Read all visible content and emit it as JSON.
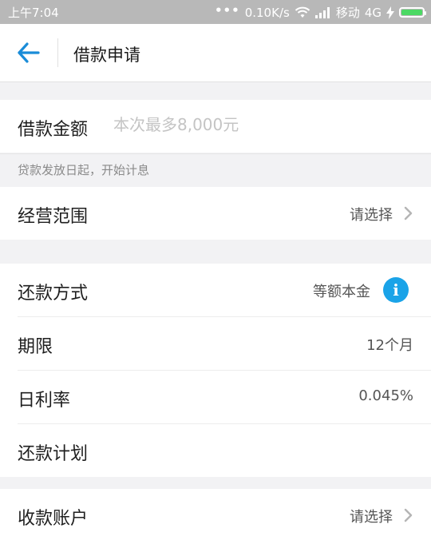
{
  "status_bar": {
    "time": "上午7:04",
    "dots": "•••",
    "speed": "0.10K/s",
    "carrier": "移动",
    "network": "4G"
  },
  "header": {
    "title": "借款申请",
    "accent_color": "#1a8cd8"
  },
  "amount": {
    "label": "借款金额",
    "placeholder": "本次最多8,000元"
  },
  "note": "贷款发放日起，开始计息",
  "business_scope": {
    "label": "经营范围",
    "value": "请选择"
  },
  "repay_method": {
    "label": "还款方式",
    "value": "等额本金",
    "icon": "i"
  },
  "term": {
    "label": "期限",
    "value": "12个月"
  },
  "daily_rate": {
    "label": "日利率",
    "value": "0.045%"
  },
  "repay_plan": {
    "label": "还款计划"
  },
  "receive_account": {
    "label": "收款账户",
    "value": "请选择"
  }
}
